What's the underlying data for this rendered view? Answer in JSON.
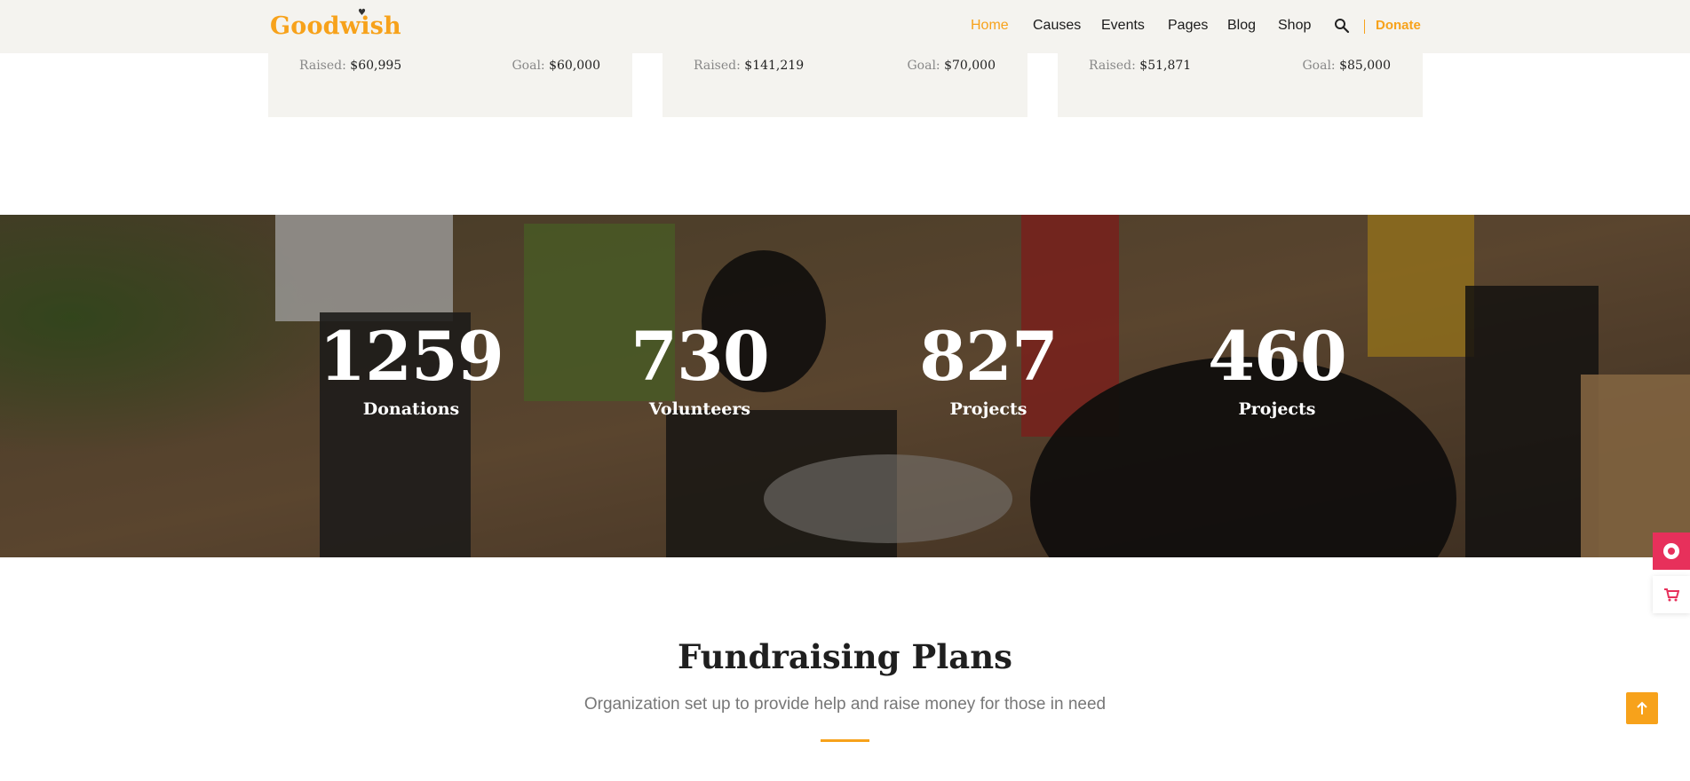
{
  "header": {
    "logo": "Goodwish",
    "nav": [
      "Home",
      "Causes",
      "Events",
      "Pages",
      "Blog",
      "Shop"
    ],
    "active_nav": "Home",
    "donate_label": "Donate"
  },
  "cards": [
    {
      "raised_label": "Raised:",
      "raised_value": "$60,995",
      "goal_label": "Goal:",
      "goal_value": "$60,000"
    },
    {
      "raised_label": "Raised:",
      "raised_value": "$141,219",
      "goal_label": "Goal:",
      "goal_value": "$70,000"
    },
    {
      "raised_label": "Raised:",
      "raised_value": "$51,871",
      "goal_label": "Goal:",
      "goal_value": "$85,000"
    }
  ],
  "counters": [
    {
      "value": "1259",
      "label": "Donations"
    },
    {
      "value": "730",
      "label": "Volunteers"
    },
    {
      "value": "827",
      "label": "Projects"
    },
    {
      "value": "460",
      "label": "Projects"
    }
  ],
  "section": {
    "title": "Fundraising Plans",
    "subtitle": "Organization set up to provide help and raise money for those in need"
  },
  "icons": {
    "search": "search-icon",
    "heart": "heart-icon",
    "support": "lifebuoy-icon",
    "cart": "cart-icon",
    "top": "arrow-up-icon"
  },
  "colors": {
    "accent": "#f7a21b",
    "header_bg": "#f4f3ef",
    "pink": "#e7305b"
  }
}
